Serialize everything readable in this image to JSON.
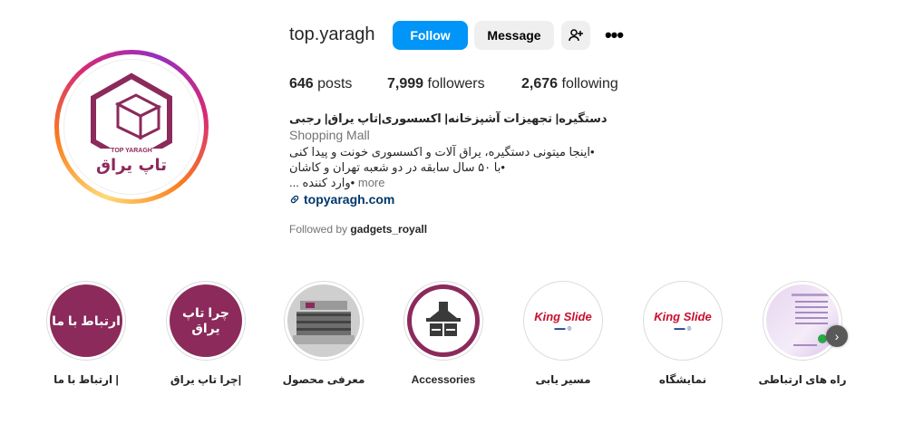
{
  "profile": {
    "username": "top.yaragh",
    "follow_label": "Follow",
    "message_label": "Message",
    "stats": {
      "posts_count": "646",
      "posts_label": "posts",
      "followers_count": "7,999",
      "followers_label": "followers",
      "following_count": "2,676",
      "following_label": "following"
    },
    "bio": {
      "title": "دستگیره| تجهیزات آشپزخانه| اکسسوری|تاپ یراق| رجبی",
      "category": "Shopping Mall",
      "line1": "•اینجا میتونی دستگیره، یراق آلات و اکسسوری خونت و پیدا کنی",
      "line2": "•با ۵۰ سال سابقه در دو شعبه تهران و کاشان",
      "line3": "•وارد کننده ...",
      "more_label": "more",
      "link": "topyaragh.com"
    },
    "followed_by_prefix": "Followed by",
    "followed_by_user": "gadgets_royall"
  },
  "avatar": {
    "logo_text": "TOP YARAGH",
    "logo_fa": "تاپ یراق"
  },
  "highlights": [
    {
      "label": "| ارتباط با ما",
      "circle_text": "ارتباط با ما",
      "kind": "maroon"
    },
    {
      "label": "|چرا تاپ یراق",
      "circle_text": "چرا تاپ یراق",
      "kind": "maroon"
    },
    {
      "label": "معرفی محصول",
      "circle_text": "",
      "kind": "photo"
    },
    {
      "label": "Accessories",
      "circle_text": "",
      "kind": "accessories"
    },
    {
      "label": "مسیر یابی",
      "circle_text": "King Slide",
      "kind": "kingslide"
    },
    {
      "label": "نمایشگاه",
      "circle_text": "King Slide",
      "kind": "kingslide"
    },
    {
      "label": "راه های ارتباطی",
      "circle_text": "",
      "kind": "contact"
    }
  ],
  "colors": {
    "follow_blue": "#0095f6",
    "brand_maroon": "#8b2a5b",
    "link_blue": "#00376b",
    "kingslide_red": "#c8102e"
  }
}
